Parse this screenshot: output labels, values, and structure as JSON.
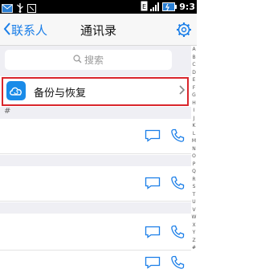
{
  "status_bar": {
    "time": "9:3"
  },
  "nav": {
    "back_label": "联系人",
    "title": "通讯录"
  },
  "search": {
    "placeholder": "搜索"
  },
  "backup": {
    "label": "备份与恢复"
  },
  "section": {
    "letter": "#"
  },
  "index_letters": [
    "A",
    "B",
    "C",
    "D",
    "E",
    "F",
    "G",
    "H",
    "I",
    "J",
    "K",
    "L",
    "M",
    "N",
    "O",
    "P",
    "Q",
    "R",
    "S",
    "T",
    "U",
    "V",
    "W",
    "X",
    "Y",
    "Z",
    "#"
  ],
  "colors": {
    "accent": "#1a7ee8",
    "highlight": "#d9262c",
    "background": "#efeff4"
  }
}
